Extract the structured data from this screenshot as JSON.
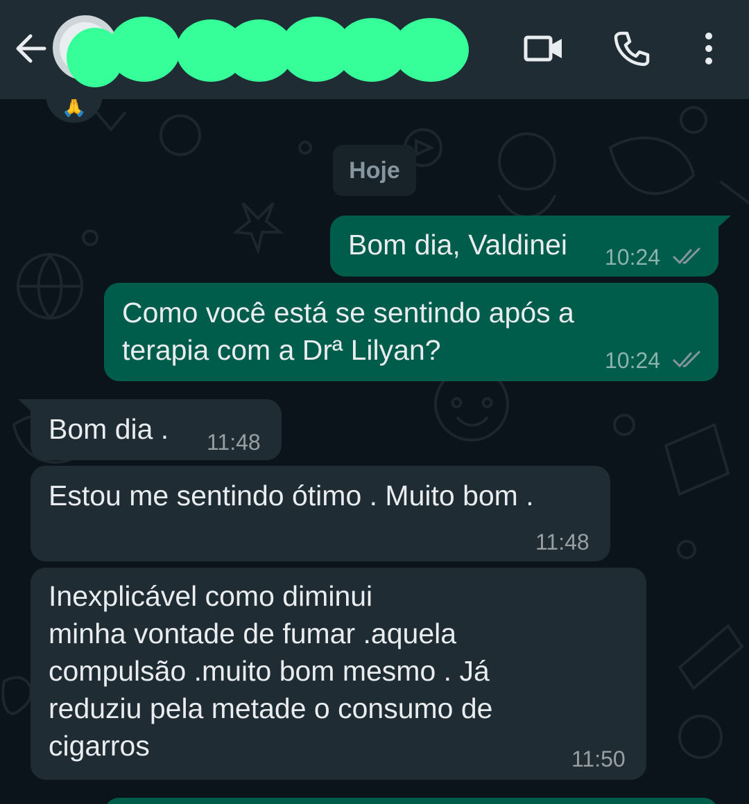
{
  "header": {
    "back_icon": "arrow-left-icon",
    "contact_name": "",
    "video_icon": "video-camera-icon",
    "call_icon": "phone-icon",
    "menu_icon": "more-vertical-icon",
    "redaction_color": "#36ff9a"
  },
  "chat": {
    "reaction_emoji": "🙏",
    "date_label": "Hoje",
    "messages": [
      {
        "direction": "outgoing",
        "text": "Bom dia, Valdinei",
        "time": "10:24",
        "status": "read"
      },
      {
        "direction": "outgoing",
        "text": "Como você está se sentindo após a\nterapia com a Drª Lilyan?",
        "time": "10:24",
        "status": "read"
      },
      {
        "direction": "incoming",
        "text": "Bom dia .",
        "time": "11:48"
      },
      {
        "direction": "incoming",
        "text": "Estou me sentindo ótimo . Muito bom .",
        "time": "11:48"
      },
      {
        "direction": "incoming",
        "text": "Inexplicável como diminui\nminha vontade de fumar .aquela\ncompulsão .muito bom mesmo . Já\nreduziu pela metade o consumo de\ncigarros",
        "time": "11:50"
      }
    ]
  },
  "colors": {
    "header_bg": "#1f2c34",
    "chat_bg": "#0b141a",
    "outgoing_bubble": "#005c4b",
    "incoming_bubble": "#202c33",
    "read_ticks": "#8696a0"
  }
}
